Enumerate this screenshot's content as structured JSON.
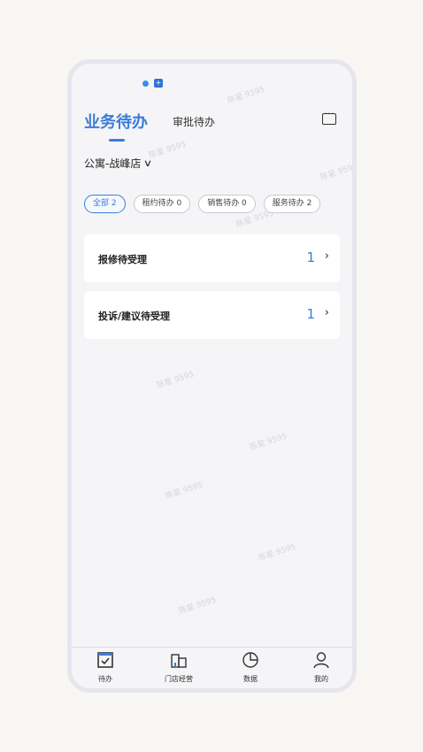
{
  "header": {
    "tab_active": "业务待办",
    "tab_inactive": "审批待办"
  },
  "store": {
    "name": "公寓-战峰店"
  },
  "chips": [
    {
      "label": "全部 2",
      "active": true
    },
    {
      "label": "租约待办 0",
      "active": false
    },
    {
      "label": "销售待办 0",
      "active": false
    },
    {
      "label": "服务待办 2",
      "active": false
    }
  ],
  "cards": [
    {
      "title": "报修待受理",
      "count": "1"
    },
    {
      "title": "投诉/建议待受理",
      "count": "1"
    }
  ],
  "bottom_nav": [
    {
      "label": "待办",
      "icon": "checkbox-icon"
    },
    {
      "label": "门店经营",
      "icon": "building-icon"
    },
    {
      "label": "数据",
      "icon": "pie-chart-icon"
    },
    {
      "label": "我的",
      "icon": "person-icon"
    }
  ],
  "watermark": {
    "text": "陈星 9595"
  },
  "colors": {
    "accent": "#3a7dd8",
    "background": "#f5f5f7"
  }
}
